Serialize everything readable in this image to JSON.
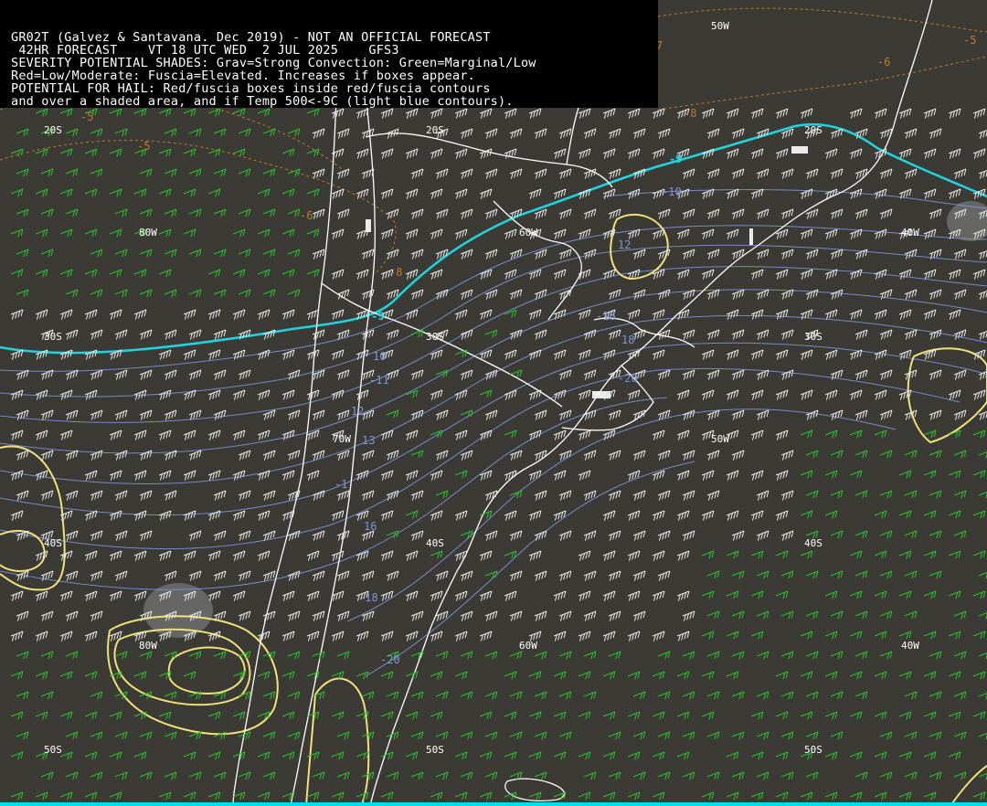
{
  "header": {
    "line1": "GR02T (Galvez & Santavana. Dec 2019) - NOT AN OFFICIAL FORECAST",
    "line2": " 42HR FORECAST    VT 18 UTC WED  2 JUL 2025    GFS3",
    "line3": "SEVERITY POTENTIAL SHADES: Grav=Strong Convection: Green=Marginal/Low",
    "line4": "Red=Low/Moderate: Fuscia=Elevated. Increases if boxes appear.",
    "line5": "POTENTIAL FOR HAIL: Red/fuscia boxes inside red/fuscia contours",
    "line6": "and over a shaded area, and if Temp 500<-9C (light blue contours)."
  },
  "grid_labels": {
    "lat_20s": "20S",
    "lat_30s": "30S",
    "lat_40s": "40S",
    "lat_50s": "50S",
    "lon_80w": "80W",
    "lon_70w": "70W",
    "lon_60w": "60W",
    "lon_50w": "50W",
    "lon_40w": "40W"
  },
  "contour_labels": {
    "orange_neg5": "-5",
    "orange_neg6": "-6",
    "orange_neg7": "7",
    "orange_neg8": "-8",
    "cyan_neg9": "-9",
    "blue_neg10": "-10",
    "blue_10": "10",
    "blue_11": "-11",
    "blue_12": "12",
    "blue_13": "13",
    "blue_14": "-1",
    "blue_16": "16",
    "blue_18": "18",
    "blue_neg18": "-18",
    "blue_neg20": "-20",
    "blue_neg16": "-16",
    "blue_neg1": "1",
    "blue_12b": "12"
  },
  "colors": {
    "background": "#3b3a35",
    "land_outline": "#ffffff",
    "temperature_contour": "#7f95d8",
    "threshold_contour": "#1fd6e0",
    "orange_contour": "#c07a2a",
    "severity_contour": "#f0e17a",
    "green_barb": "#2fc12f",
    "white_barb": "#e8e8e8",
    "gray_shade": "#8a8a8a"
  }
}
